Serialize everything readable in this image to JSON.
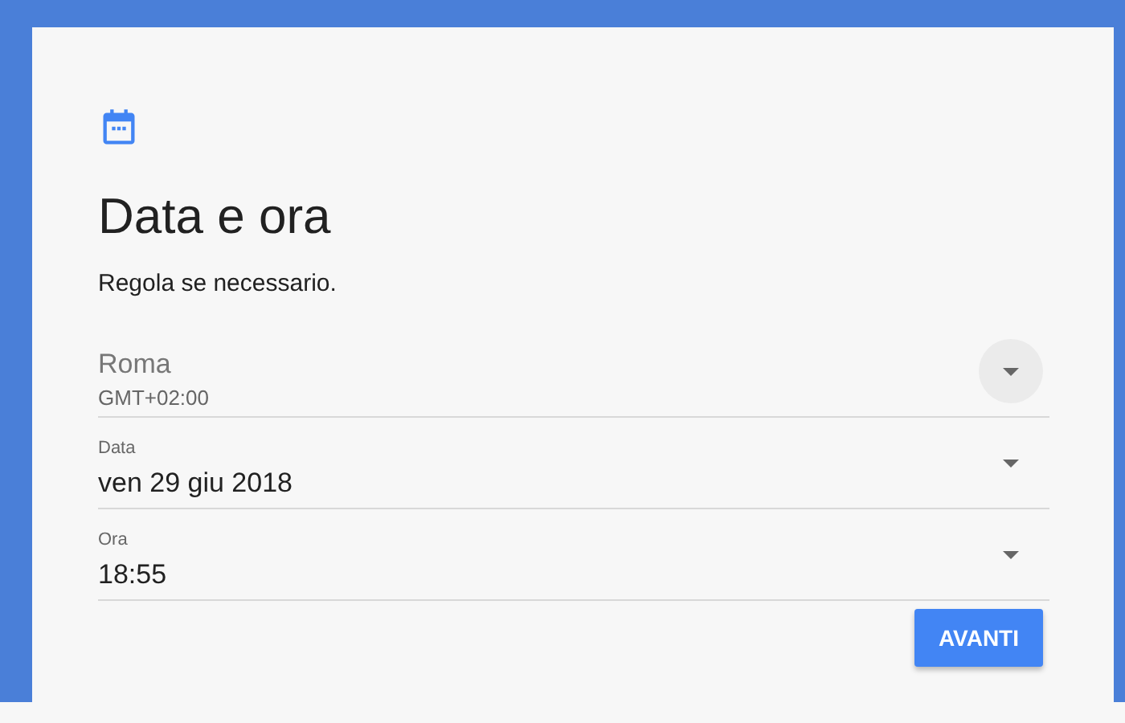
{
  "header": {
    "title": "Data e ora",
    "subtitle": "Regola se necessario."
  },
  "fields": [
    {
      "kind": "timezone",
      "value": "Roma",
      "detail": "GMT+02:00"
    },
    {
      "kind": "dropdown",
      "label": "Data",
      "value": "ven 29 giu 2018"
    },
    {
      "kind": "dropdown",
      "label": "Ora",
      "value": "18:55"
    }
  ],
  "button": "AVANTI"
}
